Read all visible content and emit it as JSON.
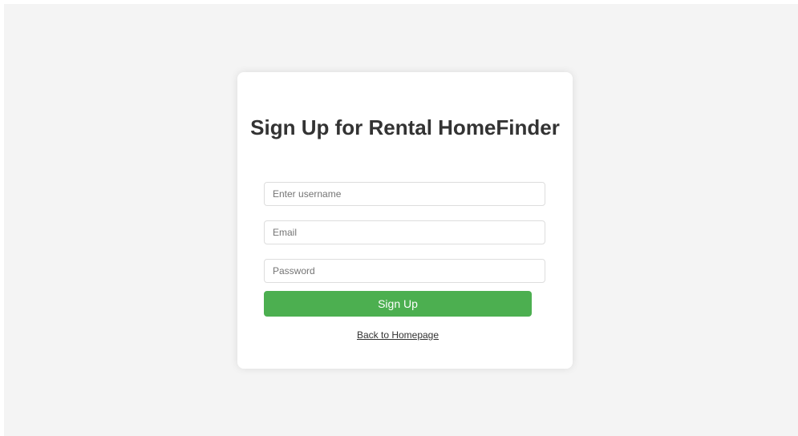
{
  "signup": {
    "title": "Sign Up for Rental HomeFinder",
    "username_placeholder": "Enter username",
    "email_placeholder": "Email",
    "password_placeholder": "Password",
    "submit_label": "Sign Up",
    "back_link_label": "Back to Homepage"
  },
  "colors": {
    "page_background": "#f4f4f4",
    "card_background": "#ffffff",
    "button_accent": "#4caf50",
    "text": "#333333"
  }
}
